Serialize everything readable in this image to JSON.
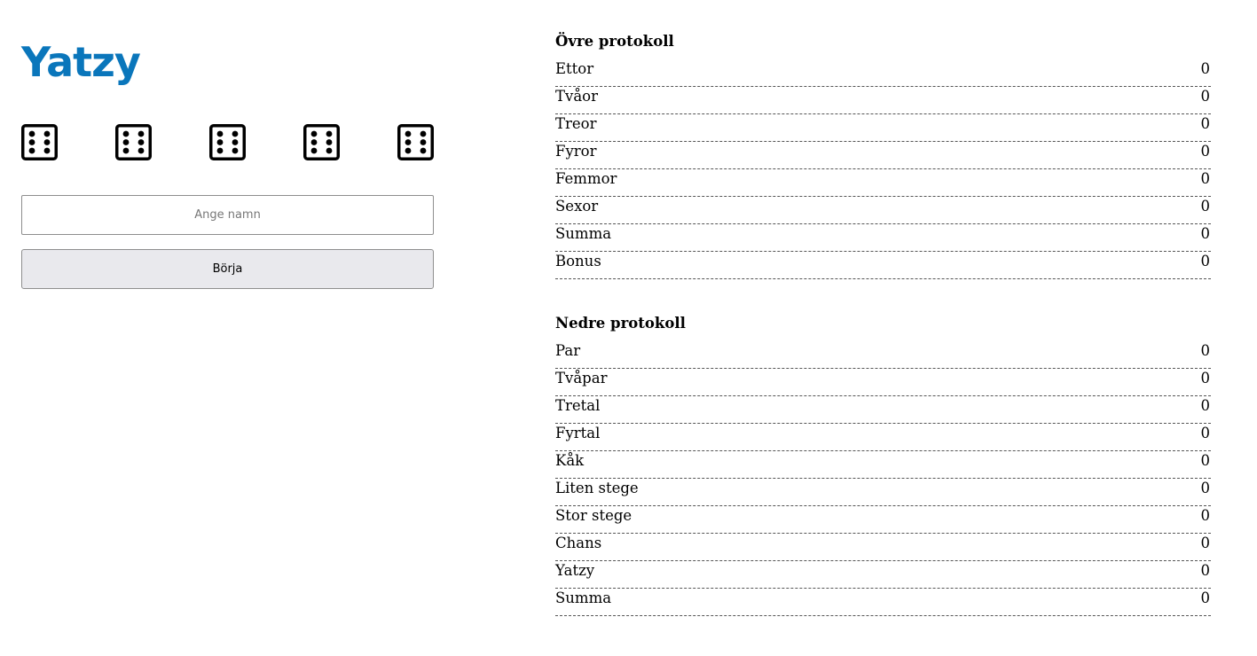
{
  "title": "Yatzy",
  "dice": [
    {
      "value": 6,
      "icon": "die-six-icon"
    },
    {
      "value": 6,
      "icon": "die-six-icon"
    },
    {
      "value": 6,
      "icon": "die-six-icon"
    },
    {
      "value": 6,
      "icon": "die-six-icon"
    },
    {
      "value": 6,
      "icon": "die-six-icon"
    }
  ],
  "name_input": {
    "value": "",
    "placeholder": "Ange namn"
  },
  "start_button": {
    "label": "Börja"
  },
  "upper": {
    "heading": "Övre protokoll",
    "rows": [
      {
        "label": "Ettor",
        "value": "0"
      },
      {
        "label": "Tvåor",
        "value": "0"
      },
      {
        "label": "Treor",
        "value": "0"
      },
      {
        "label": "Fyror",
        "value": "0"
      },
      {
        "label": "Femmor",
        "value": "0"
      },
      {
        "label": "Sexor",
        "value": "0"
      },
      {
        "label": "Summa",
        "value": "0"
      },
      {
        "label": "Bonus",
        "value": "0"
      }
    ]
  },
  "lower": {
    "heading": "Nedre protokoll",
    "rows": [
      {
        "label": "Par",
        "value": "0"
      },
      {
        "label": "Tvåpar",
        "value": "0"
      },
      {
        "label": "Tretal",
        "value": "0"
      },
      {
        "label": "Fyrtal",
        "value": "0"
      },
      {
        "label": "Kåk",
        "value": "0"
      },
      {
        "label": "Liten stege",
        "value": "0"
      },
      {
        "label": "Stor stege",
        "value": "0"
      },
      {
        "label": "Chans",
        "value": "0"
      },
      {
        "label": "Yatzy",
        "value": "0"
      },
      {
        "label": "Summa",
        "value": "0"
      }
    ]
  },
  "colors": {
    "title": "#0a76bb",
    "button_bg": "#e9e9ed",
    "border": "#8e8e8e"
  }
}
